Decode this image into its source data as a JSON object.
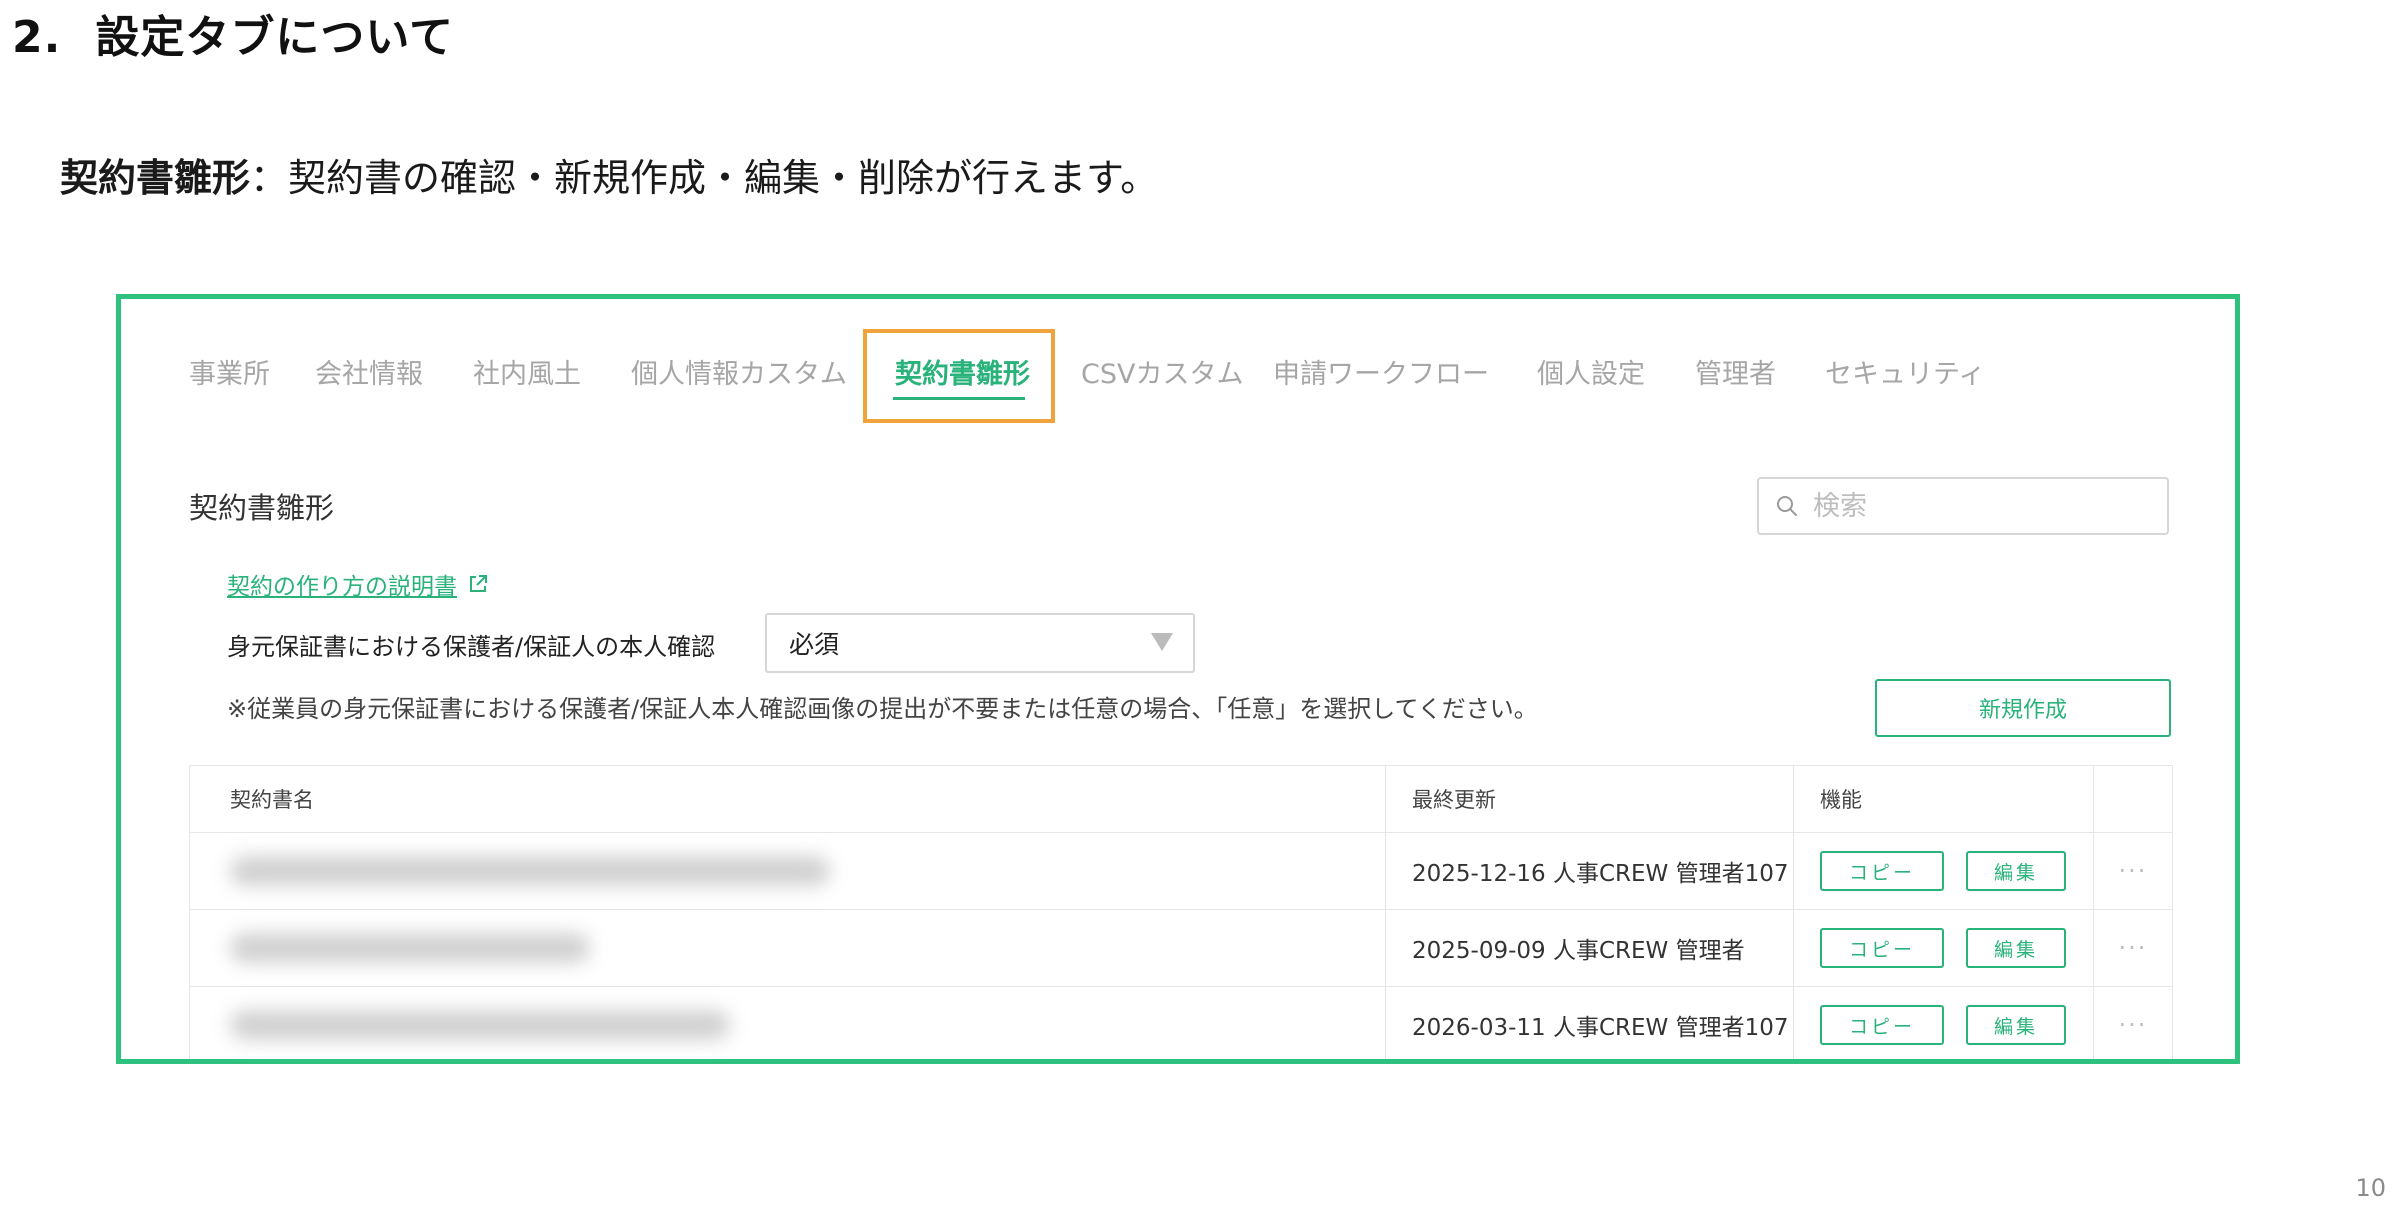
{
  "heading": {
    "number": "2.",
    "text": "設定タブについて"
  },
  "description": {
    "term": "契約書雛形",
    "text": "：契約書の確認・新規作成・編集・削除が行えます。"
  },
  "tabs": [
    {
      "label": "事業所"
    },
    {
      "label": "会社情報"
    },
    {
      "label": "社内風土"
    },
    {
      "label": "個人情報カスタム"
    },
    {
      "label": "契約書雛形",
      "active": true
    },
    {
      "label": "CSVカスタム"
    },
    {
      "label": "申請ワークフロー"
    },
    {
      "label": "個人設定"
    },
    {
      "label": "管理者"
    },
    {
      "label": "セキュリティ"
    }
  ],
  "section": {
    "title": "契約書雛形",
    "search_placeholder": "検索",
    "help_link": "契約の作り方の説明書",
    "guarantor_label": "身元保証書における保護者/保証人の本人確認",
    "guarantor_value": "必須",
    "note": "※従業員の身元保証書における保護者/保証人本人確認画像の提出が不要または任意の場合、「任意」を選択してください。",
    "new_button": "新規作成"
  },
  "table": {
    "headers": {
      "name": "契約書名",
      "updated": "最終更新",
      "functions": "機能"
    },
    "rows": [
      {
        "updated": "2025-12-16 人事CREW 管理者107",
        "copy": "コピー",
        "edit": "編集"
      },
      {
        "updated": "2025-09-09 人事CREW 管理者",
        "copy": "コピー",
        "edit": "編集"
      },
      {
        "updated": "2026-03-11 人事CREW 管理者107",
        "copy": "コピー",
        "edit": "編集"
      }
    ],
    "more_glyph": "···"
  },
  "page_number": "10",
  "colors": {
    "accent": "#2ab27b",
    "frame": "#2ec27e",
    "highlight": "#f0a33c",
    "inactive_tab": "#a6a6a6"
  }
}
